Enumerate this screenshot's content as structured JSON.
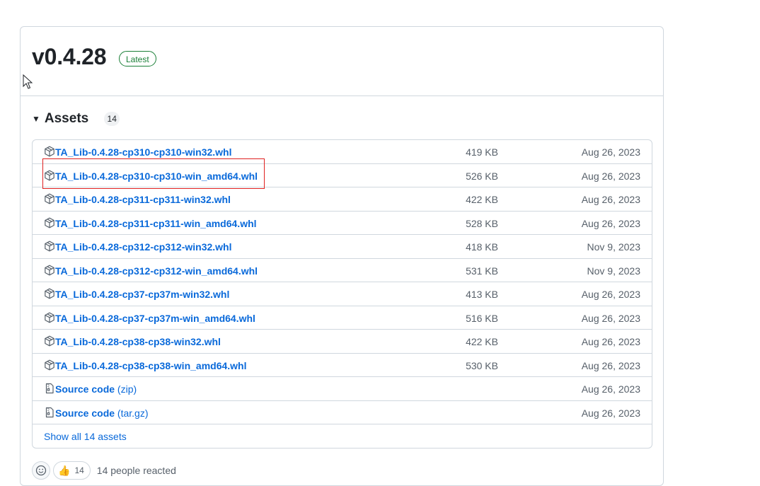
{
  "release": {
    "title": "v0.4.28",
    "badge": "Latest"
  },
  "assets": {
    "label": "Assets",
    "count": "14",
    "items": [
      {
        "name": "TA_Lib-0.4.28-cp310-cp310-win32.whl",
        "size": "419 KB",
        "date": "Aug 26, 2023",
        "icon": "package-icon"
      },
      {
        "name": "TA_Lib-0.4.28-cp310-cp310-win_amd64.whl",
        "size": "526 KB",
        "date": "Aug 26, 2023",
        "icon": "package-icon"
      },
      {
        "name": "TA_Lib-0.4.28-cp311-cp311-win32.whl",
        "size": "422 KB",
        "date": "Aug 26, 2023",
        "icon": "package-icon"
      },
      {
        "name": "TA_Lib-0.4.28-cp311-cp311-win_amd64.whl",
        "size": "528 KB",
        "date": "Aug 26, 2023",
        "icon": "package-icon"
      },
      {
        "name": "TA_Lib-0.4.28-cp312-cp312-win32.whl",
        "size": "418 KB",
        "date": "Nov 9, 2023",
        "icon": "package-icon"
      },
      {
        "name": "TA_Lib-0.4.28-cp312-cp312-win_amd64.whl",
        "size": "531 KB",
        "date": "Nov 9, 2023",
        "icon": "package-icon"
      },
      {
        "name": "TA_Lib-0.4.28-cp37-cp37m-win32.whl",
        "size": "413 KB",
        "date": "Aug 26, 2023",
        "icon": "package-icon"
      },
      {
        "name": "TA_Lib-0.4.28-cp37-cp37m-win_amd64.whl",
        "size": "516 KB",
        "date": "Aug 26, 2023",
        "icon": "package-icon"
      },
      {
        "name": "TA_Lib-0.4.28-cp38-cp38-win32.whl",
        "size": "422 KB",
        "date": "Aug 26, 2023",
        "icon": "package-icon"
      },
      {
        "name": "TA_Lib-0.4.28-cp38-cp38-win_amd64.whl",
        "size": "530 KB",
        "date": "Aug 26, 2023",
        "icon": "package-icon"
      }
    ],
    "source": [
      {
        "name": "Source code",
        "suffix": "(zip)",
        "date": "Aug 26, 2023",
        "icon": "file-zip-icon"
      },
      {
        "name": "Source code",
        "suffix": "(tar.gz)",
        "date": "Aug 26, 2023",
        "icon": "file-zip-icon"
      }
    ],
    "show_all": "Show all 14 assets"
  },
  "reactions": {
    "thumbs_count": "14",
    "summary": "14 people reacted"
  },
  "colors": {
    "link": "#0969da",
    "badge_green": "#1a7f37",
    "highlight": "#e0201f",
    "border": "#d0d7de"
  }
}
